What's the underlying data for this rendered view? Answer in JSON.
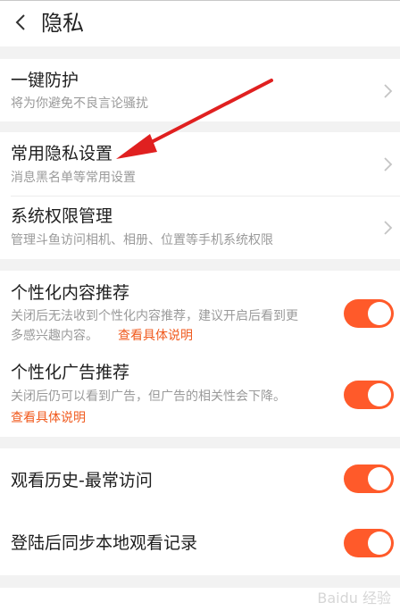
{
  "header": {
    "title": "隐私"
  },
  "one_key": {
    "title": "一键防护",
    "subtitle": "将为你避免不良言论骚扰"
  },
  "common": {
    "title": "常用隐私设置",
    "subtitle": "消息黑名单等常用设置"
  },
  "permissions": {
    "title": "系统权限管理",
    "subtitle": "管理斗鱼访问相机、相册、位置等手机系统权限"
  },
  "personal_content": {
    "title": "个性化内容推荐",
    "desc_line1": "关闭后无法收到个性化内容推荐，建议开启后看到更",
    "desc_line2": "多感兴趣内容。",
    "link": "查看具体说明",
    "enabled": true
  },
  "personal_ads": {
    "title": "个性化广告推荐",
    "desc": "关闭后仍可以看到广告，但广告的相关性会下降。",
    "link": "查看具体说明",
    "enabled": true
  },
  "history": {
    "title": "观看历史-最常访问",
    "enabled": true
  },
  "sync": {
    "title": "登陆后同步本地观看记录",
    "enabled": true
  },
  "colors": {
    "accent": "#ff5a2a",
    "link": "#f05a1e",
    "annotation_arrow": "#e02020"
  },
  "watermark": {
    "text": "Baidu 经验"
  }
}
